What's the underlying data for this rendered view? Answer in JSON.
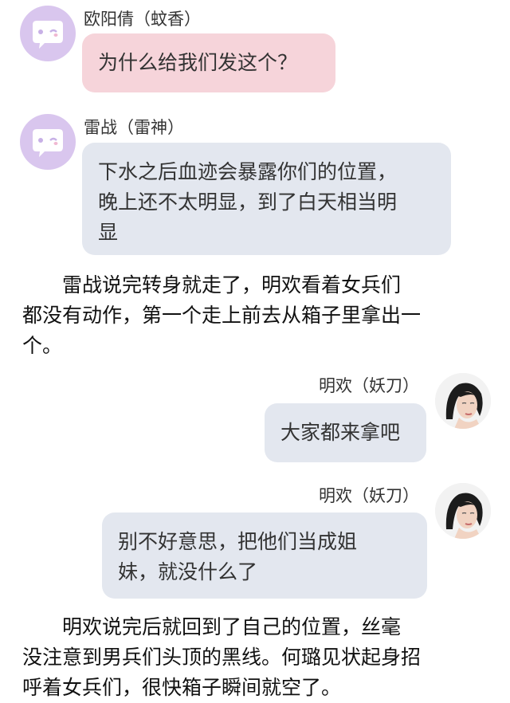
{
  "messages": [
    {
      "name": "欧阳倩（蚊香）",
      "lines": [
        "为什么给我们发这个？"
      ]
    },
    {
      "name": "雷战（雷神）",
      "lines": [
        "下水之后血迹会暴露你们的位置，",
        "晚上还不太明显，到了白天相当明",
        "显"
      ]
    },
    {
      "name": "明欢（妖刀）",
      "lines": [
        "大家都来拿吧"
      ]
    },
    {
      "name": "明欢（妖刀）",
      "lines": [
        "别不好意思，把他们当成姐",
        "妹，就没什么了"
      ]
    }
  ],
  "narration": [
    [
      "　　雷战说完转身就走了，明欢看着女兵们",
      "都没有动作，第一个走上前去从箱子里拿出一",
      "个。"
    ],
    [
      "　　明欢说完后就回到了自己的位置，丝毫",
      "没注意到男兵们头顶的黑线。何璐见状起身招",
      "呼着女兵们，很快箱子瞬间就空了。"
    ]
  ],
  "colors": {
    "bubble_pink": "#f6d4da",
    "bubble_gray": "#e3e7ef",
    "avatar_purple": "#d9c6ee"
  },
  "icons": {
    "generic_avatar": "chat-bubble-face-icon",
    "photo_avatar": "portrait-photo"
  }
}
